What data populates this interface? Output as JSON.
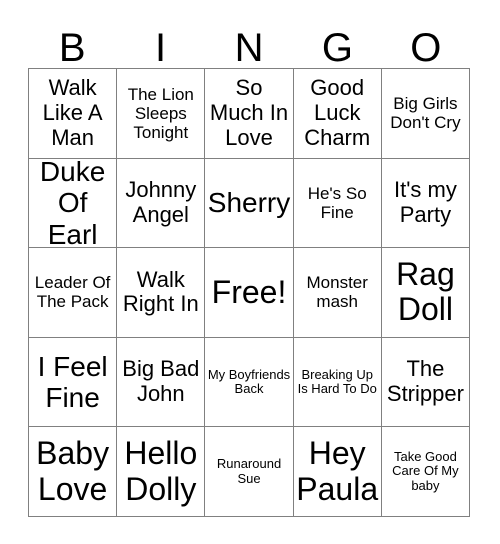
{
  "card": {
    "header_letters": [
      "B",
      "I",
      "N",
      "G",
      "O"
    ],
    "rows": [
      [
        {
          "text": "Walk Like A Man",
          "size": "md"
        },
        {
          "text": "The Lion Sleeps Tonight",
          "size": "sm"
        },
        {
          "text": "So Much In Love",
          "size": "md"
        },
        {
          "text": "Good Luck Charm",
          "size": "md"
        },
        {
          "text": "Big Girls Don't Cry",
          "size": "sm"
        }
      ],
      [
        {
          "text": "Duke Of Earl",
          "size": "lg"
        },
        {
          "text": "Johnny Angel",
          "size": "md"
        },
        {
          "text": "Sherry",
          "size": "lg"
        },
        {
          "text": "He's So Fine",
          "size": "sm"
        },
        {
          "text": "It's my Party",
          "size": "md"
        }
      ],
      [
        {
          "text": "Leader Of The Pack",
          "size": "sm"
        },
        {
          "text": "Walk Right In",
          "size": "md"
        },
        {
          "text": "Free!",
          "size": "xl"
        },
        {
          "text": "Monster mash",
          "size": "sm"
        },
        {
          "text": "Rag Doll",
          "size": "xl"
        }
      ],
      [
        {
          "text": "I Feel Fine",
          "size": "lg"
        },
        {
          "text": "Big Bad John",
          "size": "md"
        },
        {
          "text": "My Boyfriends Back",
          "size": "xs"
        },
        {
          "text": "Breaking Up Is Hard To Do",
          "size": "xs"
        },
        {
          "text": "The Stripper",
          "size": "md"
        }
      ],
      [
        {
          "text": "Baby Love",
          "size": "xl"
        },
        {
          "text": "Hello Dolly",
          "size": "xl"
        },
        {
          "text": "Runaround Sue",
          "size": "xs"
        },
        {
          "text": "Hey Paula",
          "size": "xl"
        },
        {
          "text": "Take Good Care Of My baby",
          "size": "xs"
        }
      ]
    ]
  },
  "colors": {
    "background": "#ffffff",
    "text": "#000000",
    "grid_line": "#808080"
  }
}
